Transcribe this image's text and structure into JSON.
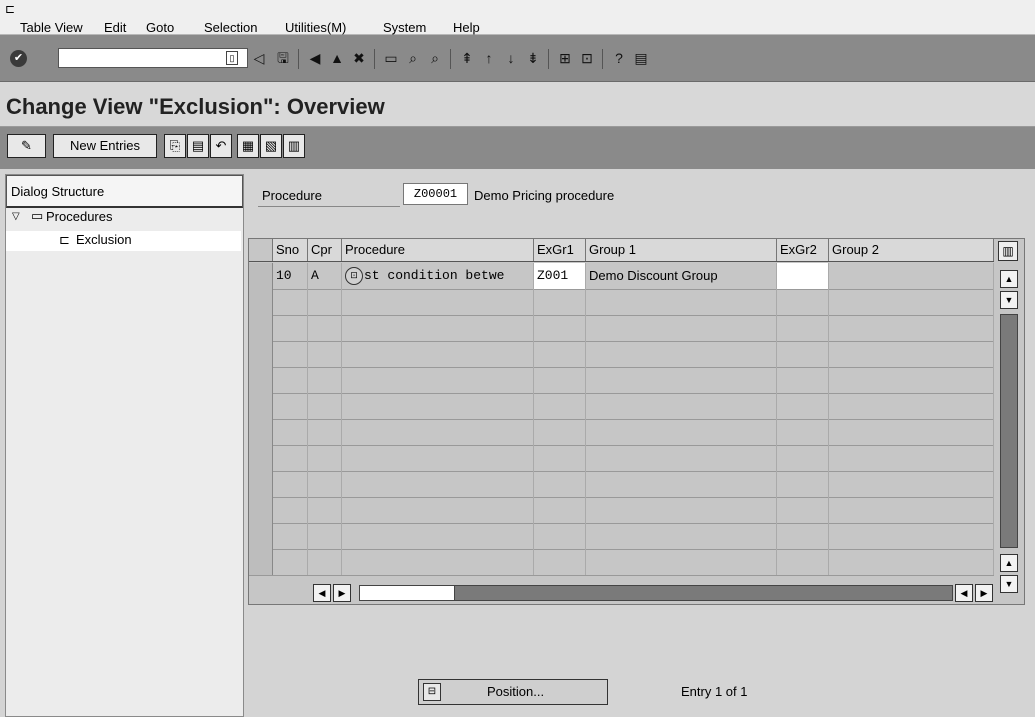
{
  "menu": {
    "items": [
      "Table View",
      "Edit",
      "Goto",
      "Selection",
      "Utilities(M)",
      "System",
      "Help"
    ]
  },
  "toolbar": {
    "command_value": "",
    "icons": [
      "back-icon",
      "save-icon",
      "back-arrow-icon",
      "exit-icon",
      "cancel-icon",
      "print-icon",
      "find-icon",
      "find-next-icon",
      "first-page-icon",
      "previous-page-icon",
      "next-page-icon",
      "last-page-icon",
      "create-session-icon",
      "shortcut-icon",
      "help-icon",
      "layout-icon"
    ]
  },
  "title": "Change View \"Exclusion\": Overview",
  "app_toolbar": {
    "new_entries": "New Entries"
  },
  "dialog_structure": {
    "header": "Dialog Structure",
    "items": [
      {
        "label": "Procedures"
      },
      {
        "label": "Exclusion"
      }
    ]
  },
  "procedure": {
    "label": "Procedure",
    "value": "Z00001",
    "description": "Demo Pricing procedure"
  },
  "table": {
    "columns": [
      "Sno",
      "Cpr",
      "Procedure",
      "ExGr1",
      "Group 1",
      "ExGr2",
      "Group 2"
    ],
    "rows": [
      {
        "sno": "10",
        "cpr": "A",
        "procedure": "st condition betwe",
        "exgr1": "Z001",
        "group1": "Demo Discount Group",
        "exgr2": "",
        "group2": ""
      }
    ]
  },
  "position_button": "Position...",
  "entry_info": "Entry 1 of 1"
}
